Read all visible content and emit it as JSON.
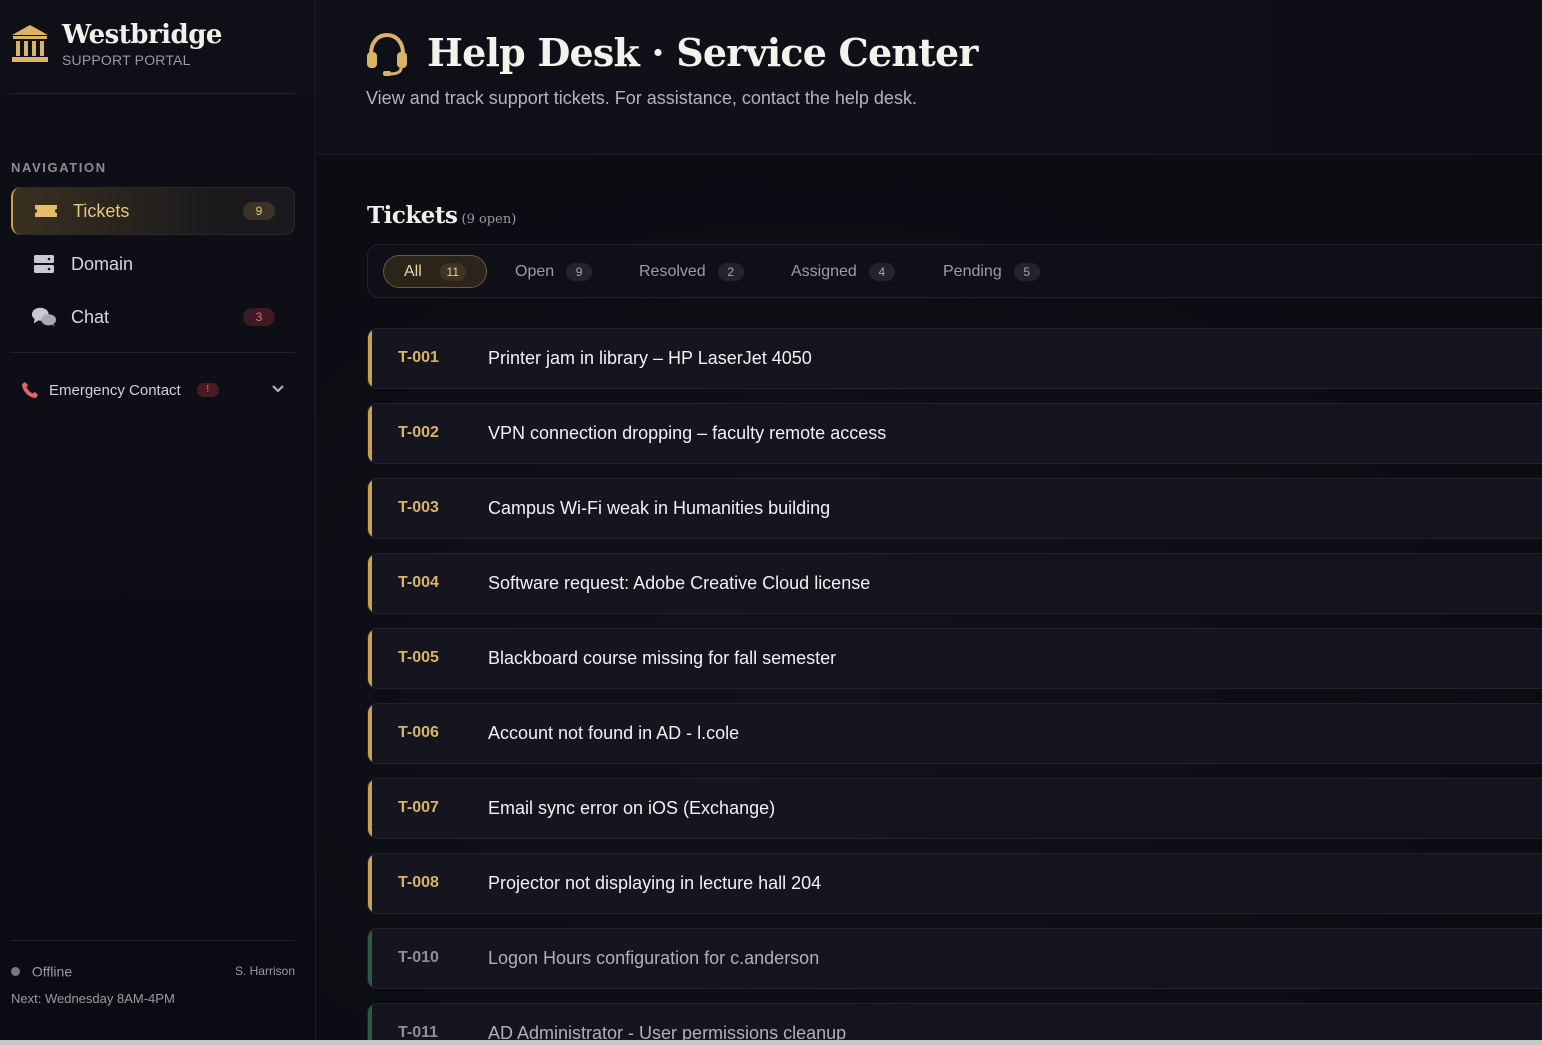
{
  "brand": {
    "name": "Westbridge",
    "subtitle": "SUPPORT PORTAL"
  },
  "navigation": {
    "title": "NAVIGATION",
    "items": [
      {
        "label": "Tickets",
        "badge": "9",
        "icon": "ticket-icon",
        "active": true
      },
      {
        "label": "Domain",
        "icon": "server-icon"
      },
      {
        "label": "Chat",
        "badge": "3",
        "icon": "chat-bubbles-icon"
      }
    ],
    "emergency": {
      "label": "Emergency Contact",
      "badge": "!",
      "icon": "phone-icon"
    }
  },
  "status": {
    "state": "Offline",
    "user": "S. Harrison",
    "next": "Next: Wednesday 8AM-4PM"
  },
  "header": {
    "title": "Help Desk · Service Center",
    "subtitle": "View and track support tickets. For assistance, contact the help desk.",
    "icon": "headset-icon"
  },
  "tickets": {
    "title": "Tickets",
    "count_label": "(9 open)",
    "filters": [
      {
        "label": "All",
        "count": "11",
        "active": true
      },
      {
        "label": "Open",
        "count": "9"
      },
      {
        "label": "Resolved",
        "count": "2"
      },
      {
        "label": "Assigned",
        "count": "4"
      },
      {
        "label": "Pending",
        "count": "5"
      }
    ],
    "rows": [
      {
        "id": "T-001",
        "title": "Printer jam in library – HP LaserJet 4050"
      },
      {
        "id": "T-002",
        "title": "VPN connection dropping – faculty remote access"
      },
      {
        "id": "T-003",
        "title": "Campus Wi-Fi weak in Humanities building"
      },
      {
        "id": "T-004",
        "title": "Software request: Adobe Creative Cloud license"
      },
      {
        "id": "T-005",
        "title": "Blackboard course missing for fall semester"
      },
      {
        "id": "T-006",
        "title": "Account not found in AD - l.cole"
      },
      {
        "id": "T-007",
        "title": "Email sync error on iOS (Exchange)"
      },
      {
        "id": "T-008",
        "title": "Projector not displaying in lecture hall 204"
      },
      {
        "id": "T-010",
        "title": "Logon Hours configuration for c.anderson"
      },
      {
        "id": "T-011",
        "title": "AD Administrator - User permissions cleanup"
      }
    ]
  },
  "colors": {
    "accent": "#c9a24e",
    "background": "#0b0b12",
    "danger": "#e26b78",
    "resolved": "#2f5a46"
  }
}
